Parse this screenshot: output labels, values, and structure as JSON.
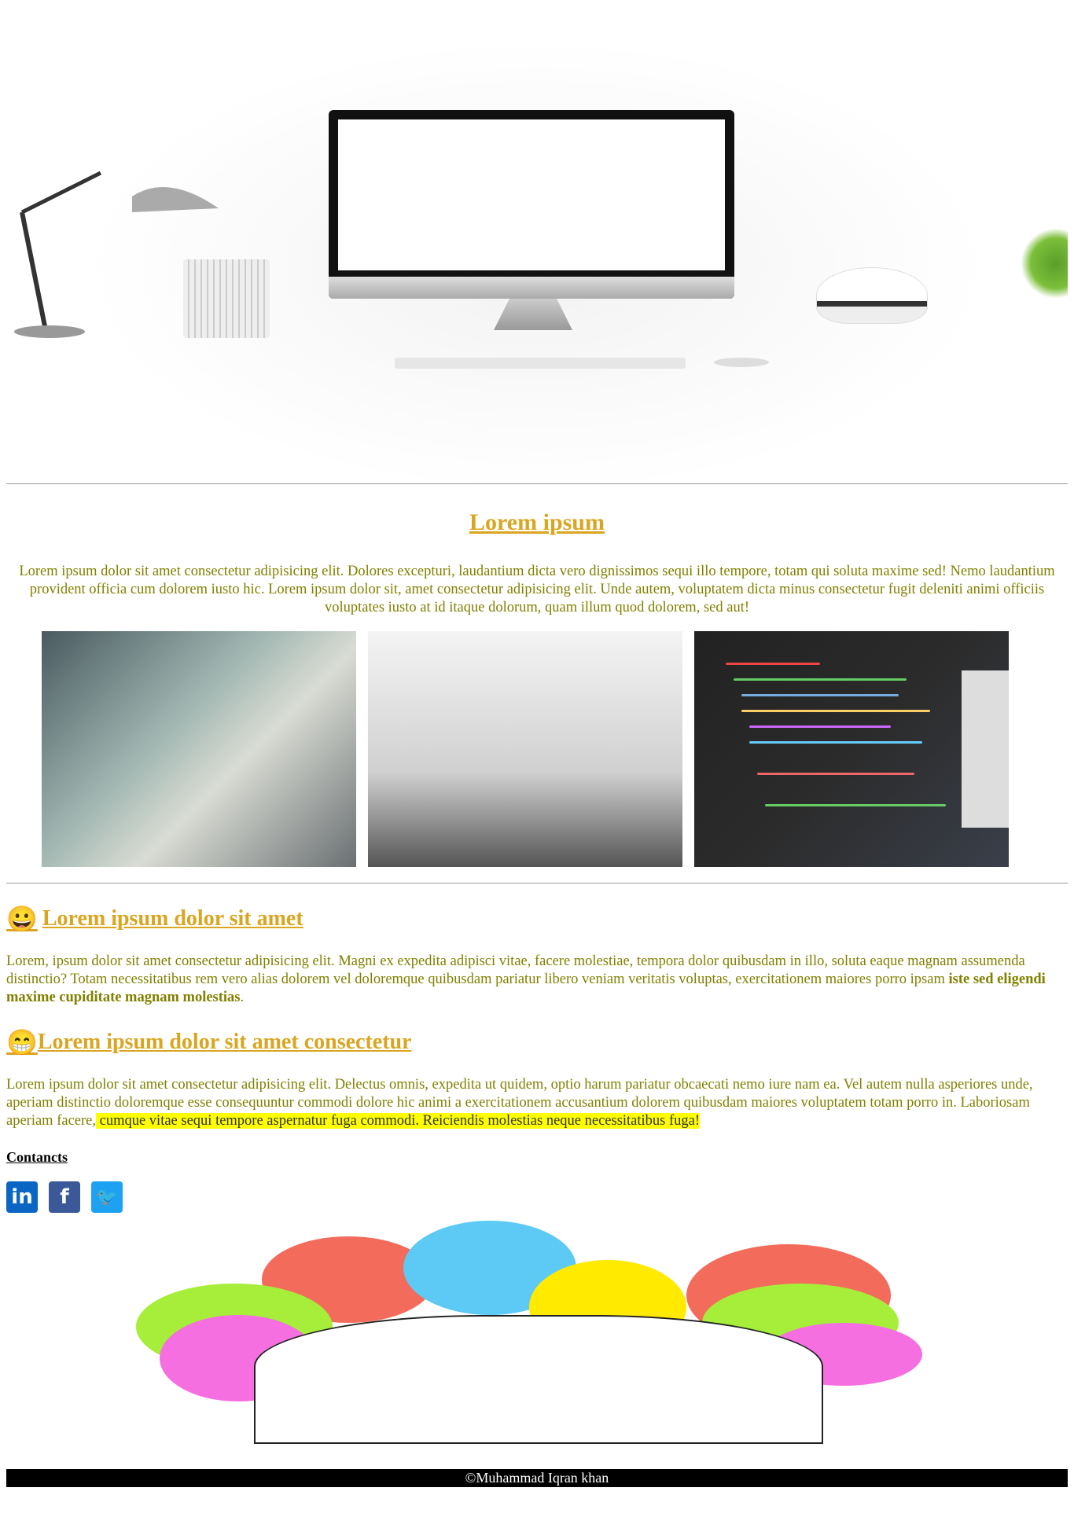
{
  "hero": {
    "alt": "desk with computer"
  },
  "intro": {
    "title": "Lorem ipsum",
    "text": "Lorem ipsum dolor sit amet consectetur adipisicing elit. Dolores excepturi, laudantium dicta vero dignissimos sequi illo tempore, totam qui soluta maxime sed! Nemo laudantium provident officia cum dolorem iusto hic. Lorem ipsum dolor sit, amet consectetur adipisicing elit. Unde autem, voluptatem dicta minus consectetur fugit deleniti animi officiis voluptates iusto at id itaque dolorum, quam illum quod dolorem, sed aut!"
  },
  "section1": {
    "emoji": "😀",
    "title": "Lorem ipsum dolor sit amet",
    "text": "Lorem, ipsum dolor sit amet consectetur adipisicing elit. Magni ex expedita adipisci vitae, facere molestiae, tempora dolor quibusdam in illo, soluta eaque magnam assumenda distinctio? Totam necessitatibus rem vero alias dolorem vel doloremque quibusdam pariatur libero veniam veritatis voluptas, exercitationem maiores porro ipsam ",
    "bold": "iste sed eligendi maxime cupiditate magnam molestias",
    "end": "."
  },
  "section2": {
    "emoji": "😁",
    "title": "Lorem ipsum dolor sit amet consectetur",
    "text": "Lorem ipsum dolor sit amet consectetur adipisicing elit. Delectus omnis, expedita ut quidem, optio harum pariatur obcaecati nemo iure nam ea. Vel autem nulla asperiores unde, aperiam distinctio doloremque esse consequuntur commodi dolore hic animi a exercitationem accusantium dolorem quibusdam maiores voluptatem totam porro in. Laboriosam aperiam facere,",
    "highlight": " cumque vitae sequi tempore aspernatur fuga commodi. Reiciendis molestias neque necessitatibus fuga!"
  },
  "contacts": {
    "label": "Contancts",
    "icons": [
      {
        "name": "linkedin-icon",
        "glyph": "in",
        "color": "#0a66c2"
      },
      {
        "name": "facebook-icon",
        "glyph": "f",
        "color": "#3b5998"
      },
      {
        "name": "twitter-icon",
        "glyph": "🐦",
        "color": "#1da1f2"
      }
    ]
  },
  "footer": {
    "text": "©Muhammad Iqran khan"
  },
  "colors": {
    "heading": "#daa520",
    "text": "#808000",
    "highlight": "#ffff00"
  }
}
